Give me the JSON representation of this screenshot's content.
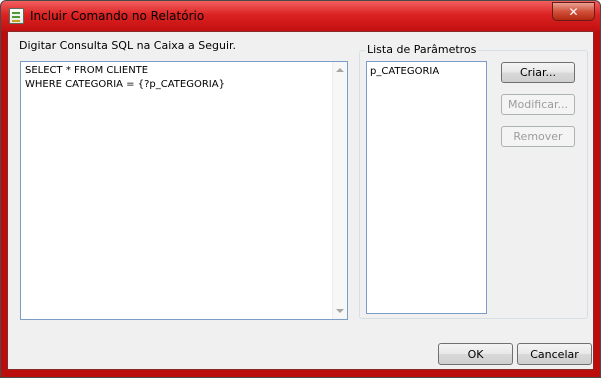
{
  "window": {
    "title": "Incluir Comando no Relatório",
    "close_glyph": "✕"
  },
  "sql": {
    "label": "Digitar Consulta SQL na Caixa a Seguir.",
    "text": "SELECT * FROM CLIENTE\nWHERE CATEGORIA = {?p_CATEGORIA}"
  },
  "params": {
    "group_label": "Lista de Parâmetros",
    "items": [
      "p_CATEGORIA"
    ]
  },
  "buttons": {
    "create": "Criar...",
    "modify": "Modificar...",
    "remove": "Remover",
    "ok": "OK",
    "cancel": "Cancelar"
  },
  "icons": {
    "app": "crystal-reports-icon",
    "close": "close-icon",
    "scroll_up": "scroll-up-arrow-icon",
    "scroll_down": "scroll-down-arrow-icon"
  }
}
